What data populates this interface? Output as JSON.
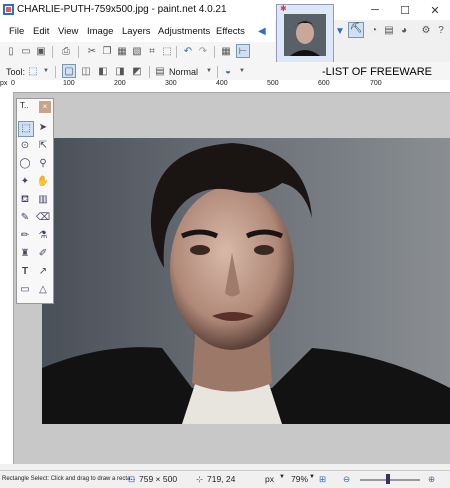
{
  "window": {
    "title": "CHARLIE-PUTH-759x500.jpg - paint.net 4.0.21",
    "minimize": "─",
    "maximize": "☐",
    "close": "✕"
  },
  "menu": {
    "items": [
      "File",
      "Edit",
      "View",
      "Image",
      "Layers",
      "Adjustments",
      "Effects"
    ]
  },
  "toolbar": {
    "tool_label": "Tool:",
    "blend_mode": "Normal"
  },
  "watermark": "-LIST OF FREEWARE",
  "rulers": {
    "unit": "px",
    "ticks": [
      "0",
      "100",
      "200",
      "300",
      "400",
      "500",
      "600",
      "700"
    ]
  },
  "tools_window": {
    "title": "T..",
    "close": "×"
  },
  "status": {
    "hint": "Rectangle Select: Click and drag to draw a recta...",
    "image_size": "759 × 500",
    "cursor_pos": "719, 24",
    "units": "px",
    "zoom": "79%"
  },
  "colors": {
    "accent": "#2d6fc4",
    "canvas_bg": "#c8c8c8"
  }
}
